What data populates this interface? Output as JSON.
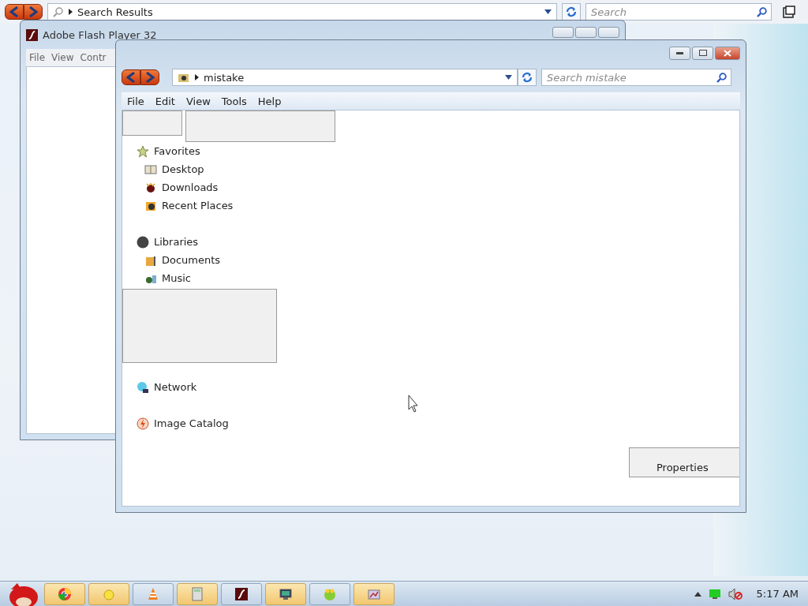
{
  "top_bar": {
    "address": "Search Results",
    "search": {
      "placeholder": "Search"
    }
  },
  "flash_window": {
    "title": "Adobe Flash Player 32",
    "menu": [
      "File",
      "View",
      "Contr"
    ]
  },
  "explorer": {
    "address": "mistake",
    "search": {
      "placeholder": "Search mistake"
    },
    "menu": [
      "File",
      "Edit",
      "View",
      "Tools",
      "Help"
    ],
    "nav": [
      {
        "label": "Favorites",
        "children": [
          {
            "label": "Desktop"
          },
          {
            "label": "Downloads"
          },
          {
            "label": "Recent Places"
          }
        ]
      },
      {
        "label": "Libraries",
        "children": [
          {
            "label": "Documents"
          },
          {
            "label": "Music"
          }
        ]
      },
      {
        "label": "Network"
      },
      {
        "label": "Image Catalog"
      }
    ],
    "properties": "Properties"
  },
  "clock": "5:17 AM"
}
